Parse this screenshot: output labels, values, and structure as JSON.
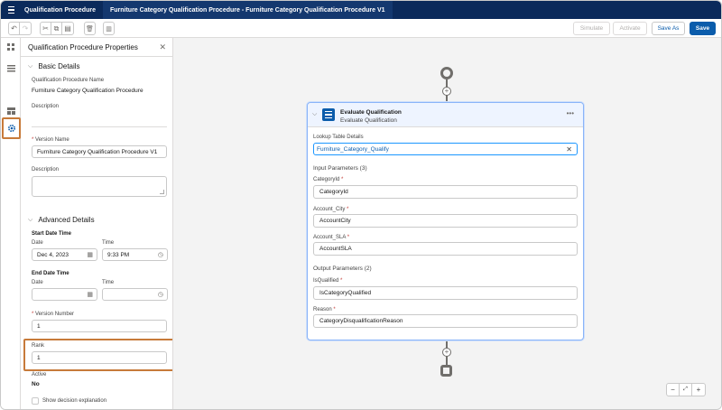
{
  "topbar": {
    "app_tab": "Qualification Procedure",
    "doc_tab": "Furniture Category Qualification Procedure - Furniture Category Qualification Procedure V1"
  },
  "toolbar": {
    "simulate": "Simulate",
    "activate": "Activate",
    "save_as": "Save As",
    "save": "Save"
  },
  "panel": {
    "title": "Qualification Procedure Properties",
    "basic_section": "Basic Details",
    "name_label": "Qualification Procedure Name",
    "name_value": "Furniture Category Qualification Procedure",
    "description_label": "Description",
    "version_name_label": "Version Name",
    "version_name_value": "Furniture Category Qualification Procedure V1",
    "version_desc_label": "Description",
    "advanced_section": "Advanced Details",
    "start_label": "Start Date Time",
    "date_label": "Date",
    "time_label": "Time",
    "start_date_value": "Dec 4, 2023",
    "start_time_value": "9:33 PM",
    "end_label": "End Date Time",
    "end_date_label": "Date",
    "end_time_label": "Time",
    "version_number_label": "Version Number",
    "version_number_value": "1",
    "rank_label": "Rank",
    "rank_value": "1",
    "active_label": "Active",
    "active_value": "No",
    "show_explanation": "Show decision explanation"
  },
  "card": {
    "title": "Evaluate Qualification",
    "subtitle": "Evaluate Qualification",
    "lookup_label": "Lookup Table Details",
    "lookup_value": "Furniture_Category_Qualify",
    "input_header": "Input Parameters (3)",
    "p1_label": "CategoryId",
    "p1_value": "CategoryId",
    "p2_label": "Account_City",
    "p2_value": "AccountCity",
    "p3_label": "Account_SLA",
    "p3_value": "AccountSLA",
    "output_header": "Output Parameters (2)",
    "o1_label": "IsQualified",
    "o1_value": "IsCategoryQualified",
    "o2_label": "Reason",
    "o2_value": "CategoryDisqualificationReason"
  },
  "highlight_color": "#c77a3a",
  "brand_color": "#0b5cab"
}
